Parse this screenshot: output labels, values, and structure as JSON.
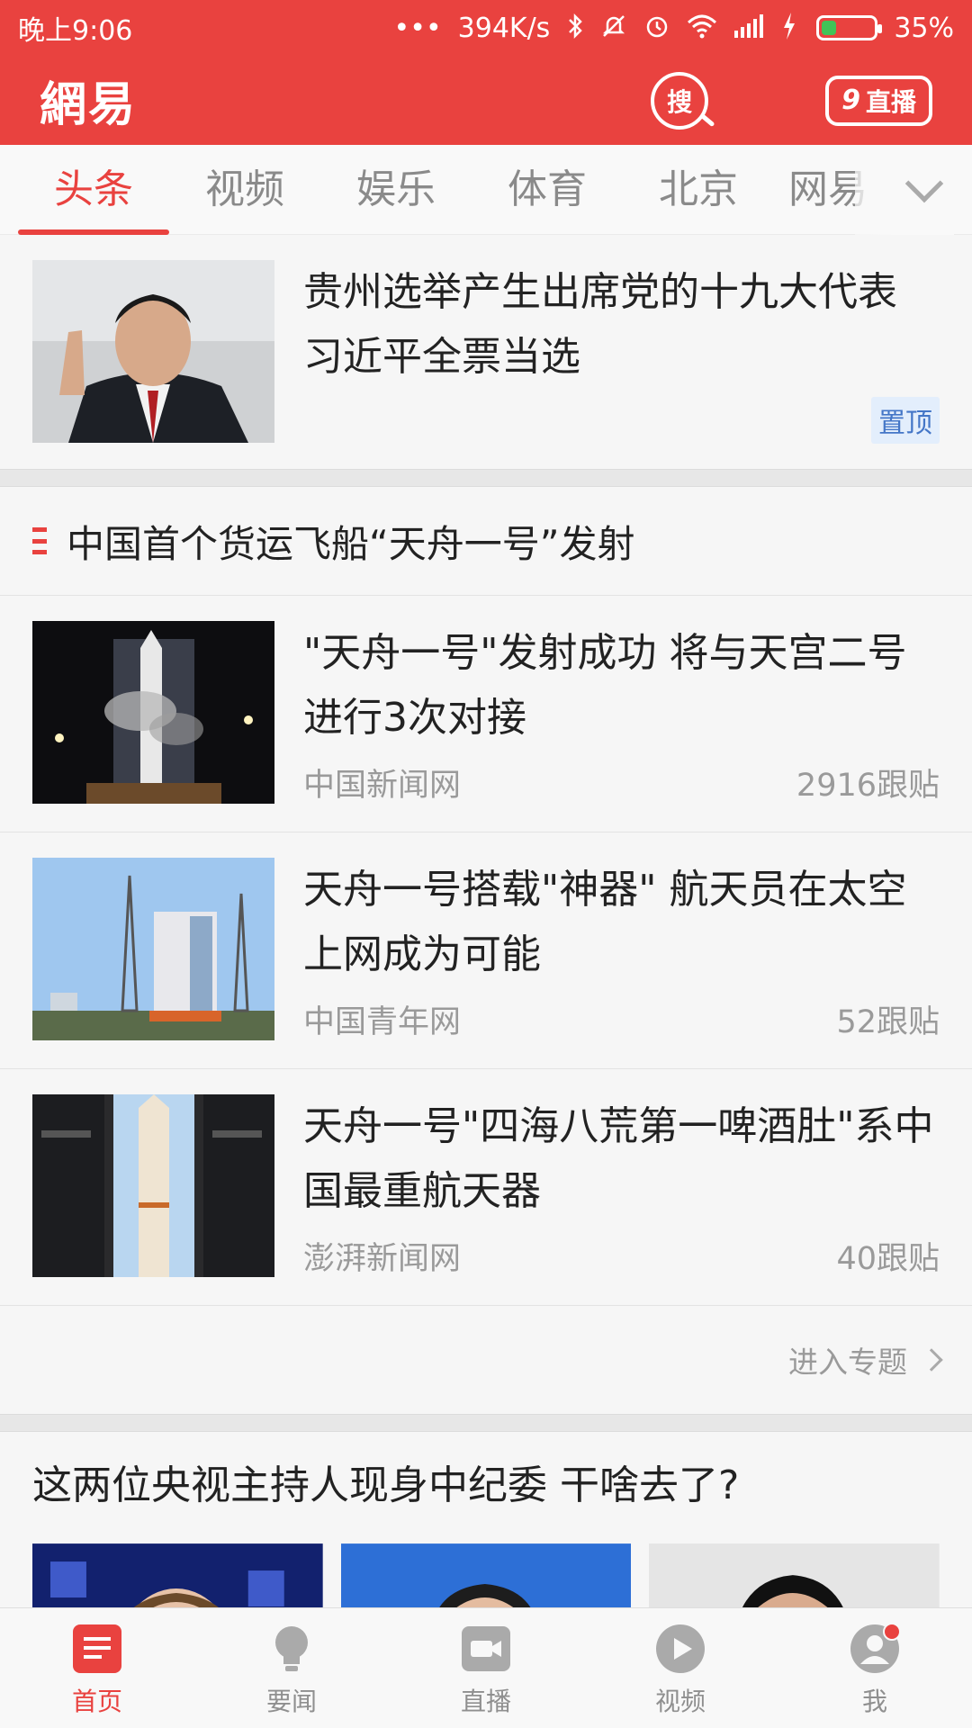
{
  "status_bar": {
    "time": "晚上9:06",
    "dots": "•••",
    "network_speed": "394K/s",
    "battery": "35%",
    "battery_level": 0.35
  },
  "app_bar": {
    "logo": "網易",
    "search_label": "搜",
    "live_count": "9",
    "live_label": "直播"
  },
  "tabs": [
    {
      "label": "头条",
      "active": true
    },
    {
      "label": "视频"
    },
    {
      "label": "娱乐"
    },
    {
      "label": "体育"
    },
    {
      "label": "北京"
    },
    {
      "label": "网易"
    }
  ],
  "pinned": {
    "title": "贵州选举产生出席党的十九大代表 习近平全票当选",
    "badge": "置顶"
  },
  "topic": {
    "heading": "中国首个货运飞船“天舟一号”发射",
    "items": [
      {
        "title": "\"天舟一号\"发射成功 将与天宫二号进行3次对接",
        "source": "中国新闻网",
        "comments": "2916跟贴"
      },
      {
        "title": "天舟一号搭载\"神器\" 航天员在太空上网成为可能",
        "source": "中国青年网",
        "comments": "52跟贴"
      },
      {
        "title": "天舟一号\"四海八荒第一啤酒肚\"系中国最重航天器",
        "source": "澎湃新闻网",
        "comments": "40跟贴"
      }
    ],
    "enter_label": "进入专题"
  },
  "multi": {
    "title": "这两位央视主持人现身中纪委 干啥去了?"
  },
  "bottom_nav": [
    {
      "label": "首页",
      "icon": "home-icon",
      "active": true
    },
    {
      "label": "要闻",
      "icon": "lightbulb-icon"
    },
    {
      "label": "直播",
      "icon": "camera-icon"
    },
    {
      "label": "视频",
      "icon": "play-icon"
    },
    {
      "label": "我",
      "icon": "user-icon"
    }
  ],
  "colors": {
    "brand": "#e9423f",
    "pin_badge_bg": "#e3eefc",
    "pin_badge_text": "#4476c7"
  }
}
